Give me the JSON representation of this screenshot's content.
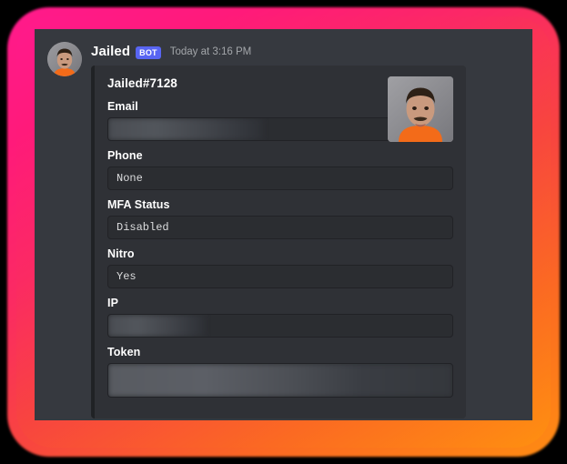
{
  "frame": {
    "gradient_start": "#ff1a8c",
    "gradient_mid": "#f8453f",
    "gradient_end": "#ff9010",
    "background": "#000000"
  },
  "chat": {
    "background": "#36393f"
  },
  "message": {
    "author": "Jailed",
    "bot_badge": "BOT",
    "timestamp": "Today at 3:16 PM",
    "avatar_icon": "mugshot-avatar"
  },
  "embed": {
    "accent_color": "#202225",
    "background": "#2f3136",
    "title": "Jailed#7128",
    "thumbnail_icon": "mugshot-thumbnail",
    "fields": [
      {
        "name": "Email",
        "value": "",
        "redacted": true
      },
      {
        "name": "Phone",
        "value": "None",
        "redacted": false
      },
      {
        "name": "MFA Status",
        "value": "Disabled",
        "redacted": false
      },
      {
        "name": "Nitro",
        "value": "Yes",
        "redacted": false
      },
      {
        "name": "IP",
        "value": "",
        "redacted": true
      },
      {
        "name": "Token",
        "value": "",
        "redacted": true
      }
    ]
  }
}
